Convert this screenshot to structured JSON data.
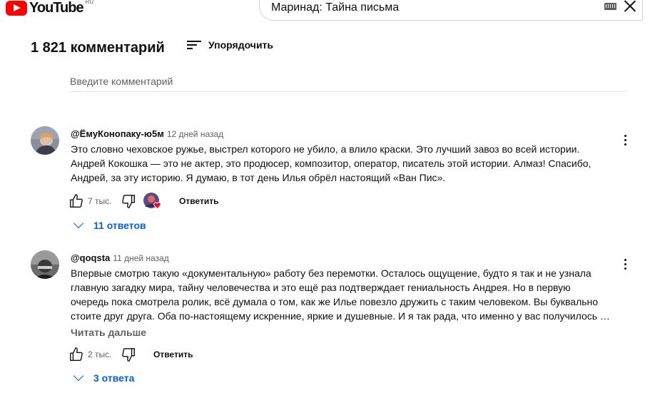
{
  "header": {
    "logo_text": "YouTube",
    "region": "RU",
    "search_value": "Маринад: Тайна письма"
  },
  "comments_section": {
    "count_label": "1 821 комментарий",
    "sort_label": "Упорядочить",
    "add_placeholder": "Введите комментарий"
  },
  "comments": [
    {
      "author": "@ЁмуКонопаку-ю5м",
      "time": "12 дней назад",
      "lines": [
        "Это словно чеховское ружье, выстрел которого не убило, а влило краски. Это лучший завоз во всей истории.",
        "Андрей Кокошка — это не актер, это продюсер, композитор, оператор, писатель этой истории. Алмаз! Спасибо,",
        "Андрей, за эту историю. Я думаю, в тот день Илья обрёл настоящий «Ван Пис»."
      ],
      "likes": "7 тыс.",
      "reply_label": "Ответить",
      "replies_label": "11 ответов"
    },
    {
      "author": "@qoqsta",
      "time": "11 дней назад",
      "lines": [
        "Впервые смотрю такую «документальную» работу без перемотки. Осталось ощущение, будто я так и не узнала",
        "главную загадку мира, тайну человечества и это ещё раз подтверждает гениальность Андрея. Но в первую",
        "очередь пока смотрела ролик, всё думала о том, как же Илье повезло дружить с таким человеком. Вы буквально",
        "стоите друг друга. Оба по-настоящему искренние, яркие и душевные. И я так рада, что именно у вас получилось …"
      ],
      "read_more": "Читать дальше",
      "likes": "2 тыс.",
      "reply_label": "Ответить",
      "replies_label": "3 ответа"
    }
  ],
  "colors": {
    "brand_red": "#ff0000",
    "link_blue": "#065fd4",
    "secondary_text": "#606060"
  }
}
